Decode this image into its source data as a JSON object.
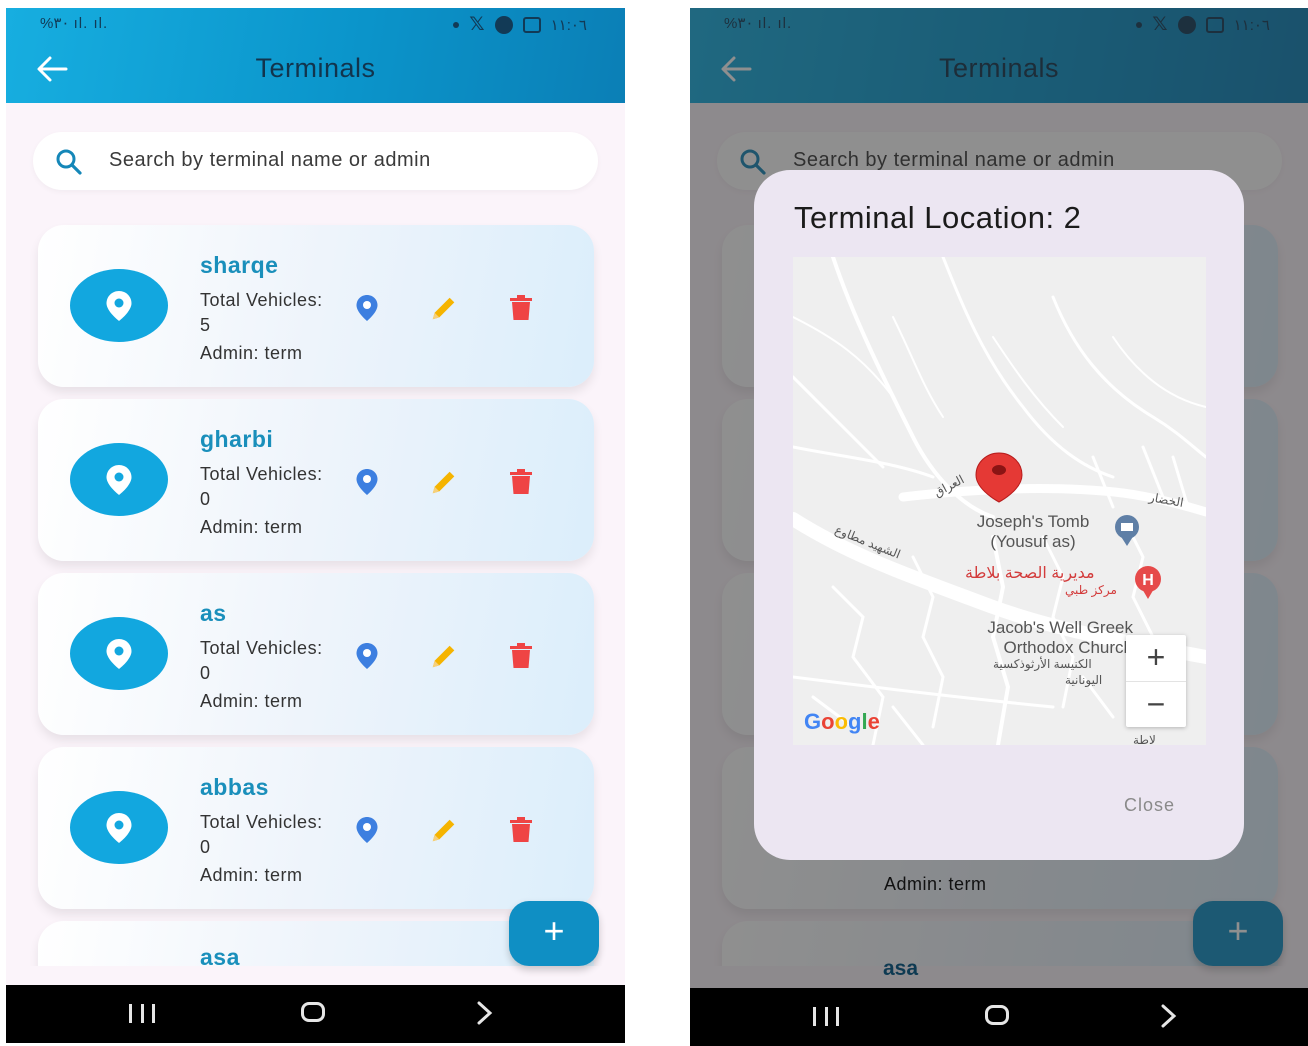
{
  "status_bar": {
    "left": "%٣٠ ıl. ıl.",
    "time": "١١:٠٦"
  },
  "app_bar": {
    "title": "Terminals"
  },
  "search": {
    "placeholder": "Search by terminal name or admin"
  },
  "terminals": [
    {
      "name": "sharqe",
      "vehicles": "Total Vehicles: 5",
      "admin": "Admin: term"
    },
    {
      "name": "gharbi",
      "vehicles": "Total Vehicles: 0",
      "admin": "Admin: term"
    },
    {
      "name": "as",
      "vehicles": "Total Vehicles: 0",
      "admin": "Admin: term"
    },
    {
      "name": "abbas",
      "vehicles": "Total Vehicles: 0",
      "admin": "Admin: term"
    },
    {
      "name": "asa",
      "vehicles": "",
      "admin": ""
    }
  ],
  "fab": {
    "label": "+"
  },
  "dialog": {
    "title": "Terminal Location: 2",
    "close_label": "Close",
    "map": {
      "place1_line1": "Joseph's Tomb",
      "place1_line2": "(Yousuf as)",
      "place2_ar": "مديرية الصحة بلاطة",
      "place2_ar_sub": "مركز طبي",
      "place3_line1": "Jacob's Well Greek",
      "place3_line2": "Orthodox Church",
      "place3_ar1": "الكنيسة الأرثوذكسية",
      "place3_ar2": "اليونانية",
      "street1": "الشهيد مطاوع",
      "street2": "الخضار",
      "street3": "العراق",
      "street4": "لاطة",
      "zoom_in": "+",
      "zoom_out": "−",
      "attribution": "Google"
    }
  },
  "background": {
    "admin": "Admin: term",
    "asa": "asa"
  },
  "colors": {
    "app_bar": "#12a7df",
    "accent": "#1a8fbb",
    "pin": "#3d7fe0",
    "edit": "#f5b400",
    "delete": "#ef4444",
    "fab": "#0f8fc4"
  }
}
